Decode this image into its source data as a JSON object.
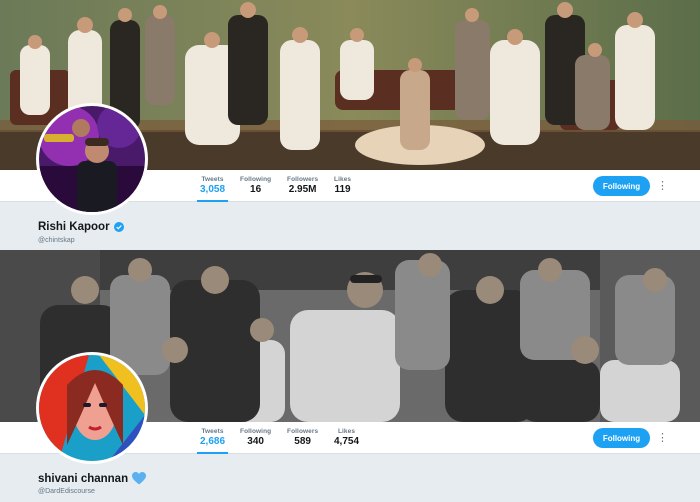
{
  "profiles": [
    {
      "name": "Rishi Kapoor",
      "handle": "@chintskap",
      "badge": "verified-icon",
      "stats": [
        {
          "label": "Tweets",
          "value": "3,058"
        },
        {
          "label": "Following",
          "value": "16"
        },
        {
          "label": "Followers",
          "value": "2.95M"
        },
        {
          "label": "Likes",
          "value": "119"
        }
      ],
      "follow_label": "Following",
      "more_label": "⋮"
    },
    {
      "name": "shivani channan",
      "handle": "@DardEdiscourse",
      "badge": "blue-heart-icon",
      "stats": [
        {
          "label": "Tweets",
          "value": "2,686"
        },
        {
          "label": "Following",
          "value": "340"
        },
        {
          "label": "Followers",
          "value": "589"
        },
        {
          "label": "Likes",
          "value": "4,754"
        }
      ],
      "follow_label": "Following",
      "more_label": "⋮"
    }
  ],
  "colors": {
    "accent": "#1da1f2",
    "background": "#e6ecf0",
    "text_primary": "#14171a",
    "text_secondary": "#657786"
  }
}
